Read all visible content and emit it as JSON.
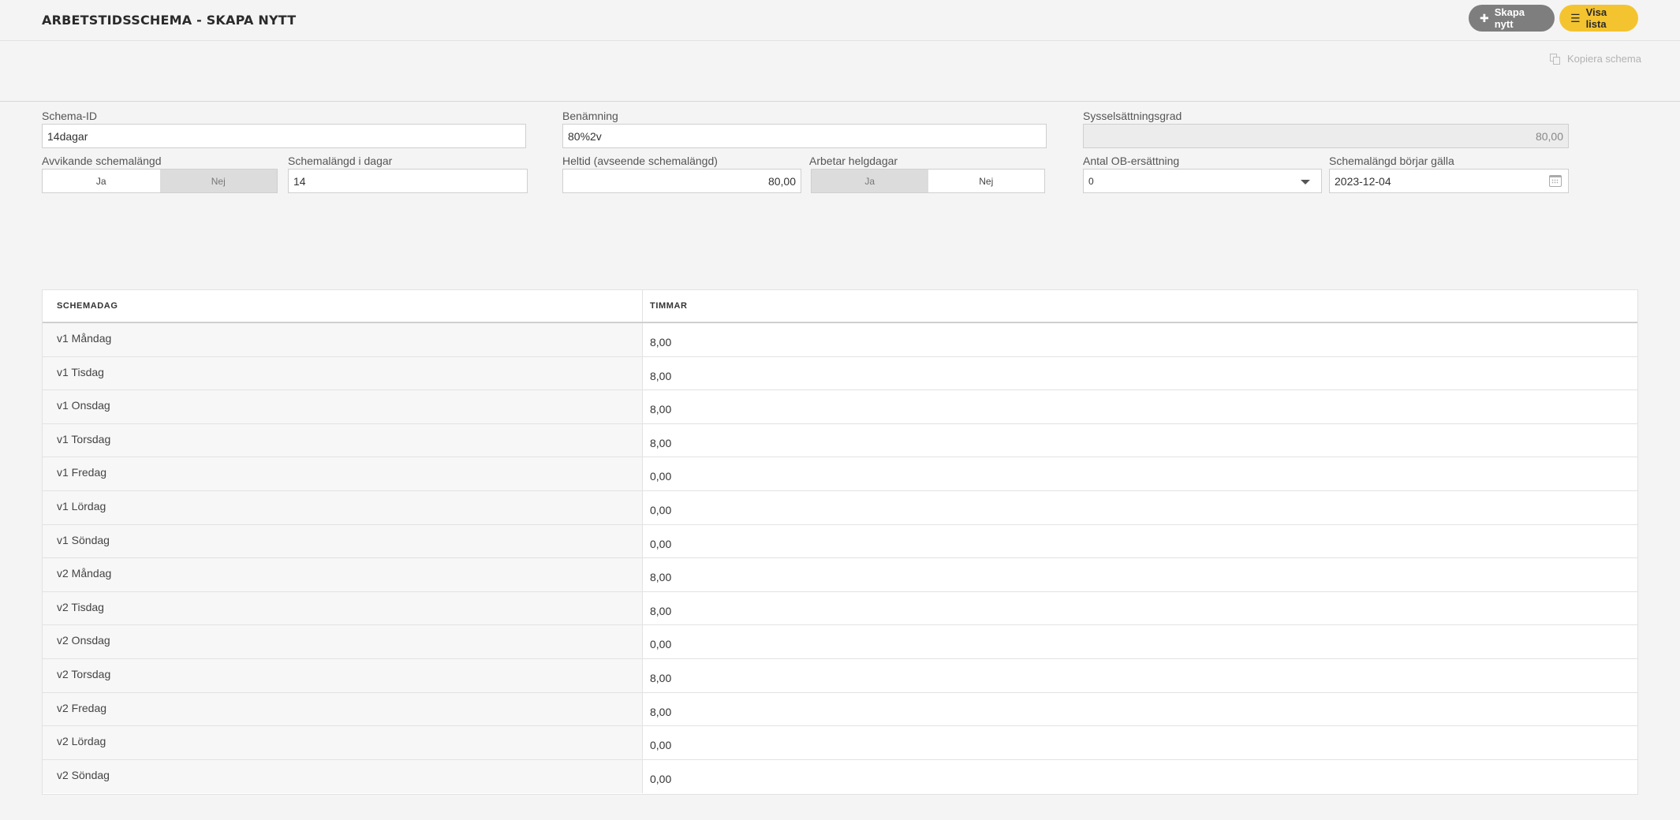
{
  "header": {
    "title": "ARBETSTIDSSCHEMA - SKAPA NYTT",
    "create_label": "Skapa nytt",
    "list_label": "Visa lista"
  },
  "toolbar": {
    "copy_label": "Kopiera schema"
  },
  "form": {
    "schema_id": {
      "label": "Schema-ID",
      "value": "14dagar"
    },
    "name": {
      "label": "Benämning",
      "value": "80%2v"
    },
    "employment_rate": {
      "label": "Sysselsättningsgrad",
      "value": "80,00"
    },
    "deviating_length": {
      "label": "Avvikande schemalängd",
      "yes": "Ja",
      "no": "Nej",
      "selected": "Nej"
    },
    "length_days": {
      "label": "Schemalängd i dagar",
      "value": "14"
    },
    "fulltime": {
      "label": "Heltid (avseende schemalängd)",
      "value": "80,00"
    },
    "works_holidays": {
      "label": "Arbetar helgdagar",
      "yes": "Ja",
      "no": "Nej",
      "selected": "Ja"
    },
    "ob_compensation": {
      "label": "Antal OB-ersättning",
      "value": "0"
    },
    "start_date": {
      "label": "Schemalängd börjar gälla",
      "value": "2023-12-04"
    }
  },
  "table": {
    "headers": [
      "SCHEMADAG",
      "TIMMAR"
    ],
    "rows": [
      {
        "day": "v1 Måndag",
        "hours": "8,00"
      },
      {
        "day": "v1 Tisdag",
        "hours": "8,00"
      },
      {
        "day": "v1 Onsdag",
        "hours": "8,00"
      },
      {
        "day": "v1 Torsdag",
        "hours": "8,00"
      },
      {
        "day": "v1 Fredag",
        "hours": "0,00"
      },
      {
        "day": "v1 Lördag",
        "hours": "0,00"
      },
      {
        "day": "v1 Söndag",
        "hours": "0,00"
      },
      {
        "day": "v2 Måndag",
        "hours": "8,00"
      },
      {
        "day": "v2 Tisdag",
        "hours": "8,00"
      },
      {
        "day": "v2 Onsdag",
        "hours": "0,00"
      },
      {
        "day": "v2 Torsdag",
        "hours": "8,00"
      },
      {
        "day": "v2 Fredag",
        "hours": "8,00"
      },
      {
        "day": "v2 Lördag",
        "hours": "0,00"
      },
      {
        "day": "v2 Söndag",
        "hours": "0,00"
      }
    ]
  },
  "colors": {
    "accent": "#f4c430",
    "secondary_button": "#7e7e7e"
  }
}
